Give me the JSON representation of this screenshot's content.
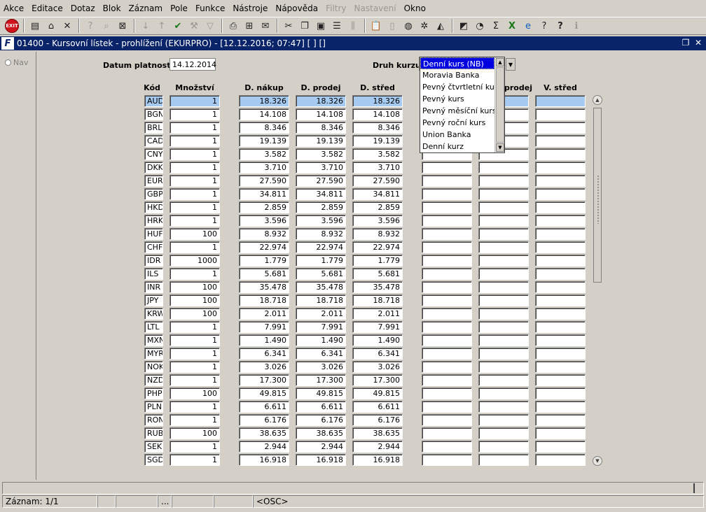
{
  "menu": [
    {
      "label": "Akce",
      "disabled": false
    },
    {
      "label": "Editace",
      "disabled": false
    },
    {
      "label": "Dotaz",
      "disabled": false
    },
    {
      "label": "Blok",
      "disabled": false
    },
    {
      "label": "Záznam",
      "disabled": false
    },
    {
      "label": "Pole",
      "disabled": false
    },
    {
      "label": "Funkce",
      "disabled": false
    },
    {
      "label": "Nástroje",
      "disabled": false
    },
    {
      "label": "Nápověda",
      "disabled": false
    },
    {
      "label": "Filtry",
      "disabled": true
    },
    {
      "label": "Nastavení",
      "disabled": true
    },
    {
      "label": "Okno",
      "disabled": false
    }
  ],
  "toolbar": {
    "exit_label": "EXIT"
  },
  "window": {
    "title": "01400 - Kursovní lístek - prohlížení (EKURPRO) - [12.12.2016; 07:47] [ ] []",
    "logo": "F"
  },
  "nav": {
    "label": "Nav"
  },
  "form": {
    "datum_label": "Datum platnosti",
    "datum_value": "14.12.2014",
    "druh_label": "Druh kurzu"
  },
  "columns": {
    "kod": "Kód",
    "mnozstvi": "Množství",
    "d_nakup": "D. nákup",
    "d_prodej": "D. prodej",
    "d_stred": "D. střed",
    "v_prodej": "prodej",
    "v_stred": "V. střed"
  },
  "dropdown": {
    "options": [
      "Denní kurs (NB)",
      "Moravia Banka",
      "Pevný čtvrtletní kurs",
      "Pevný kurs",
      "Pevný měsíční kurs",
      "Pevný roční kurs",
      "Union Banka",
      "Denní kurz"
    ],
    "selected_index": 0
  },
  "rows": [
    {
      "kod": "AUD",
      "mn": "1",
      "nakup": "18.326",
      "prodej": "18.326",
      "stred": "18.326"
    },
    {
      "kod": "BGN",
      "mn": "1",
      "nakup": "14.108",
      "prodej": "14.108",
      "stred": "14.108"
    },
    {
      "kod": "BRL",
      "mn": "1",
      "nakup": "8.346",
      "prodej": "8.346",
      "stred": "8.346"
    },
    {
      "kod": "CAD",
      "mn": "1",
      "nakup": "19.139",
      "prodej": "19.139",
      "stred": "19.139"
    },
    {
      "kod": "CNY",
      "mn": "1",
      "nakup": "3.582",
      "prodej": "3.582",
      "stred": "3.582"
    },
    {
      "kod": "DKK",
      "mn": "1",
      "nakup": "3.710",
      "prodej": "3.710",
      "stred": "3.710"
    },
    {
      "kod": "EUR",
      "mn": "1",
      "nakup": "27.590",
      "prodej": "27.590",
      "stred": "27.590"
    },
    {
      "kod": "GBP",
      "mn": "1",
      "nakup": "34.811",
      "prodej": "34.811",
      "stred": "34.811"
    },
    {
      "kod": "HKD",
      "mn": "1",
      "nakup": "2.859",
      "prodej": "2.859",
      "stred": "2.859"
    },
    {
      "kod": "HRK",
      "mn": "1",
      "nakup": "3.596",
      "prodej": "3.596",
      "stred": "3.596"
    },
    {
      "kod": "HUF",
      "mn": "100",
      "nakup": "8.932",
      "prodej": "8.932",
      "stred": "8.932"
    },
    {
      "kod": "CHF",
      "mn": "1",
      "nakup": "22.974",
      "prodej": "22.974",
      "stred": "22.974"
    },
    {
      "kod": "IDR",
      "mn": "1000",
      "nakup": "1.779",
      "prodej": "1.779",
      "stred": "1.779"
    },
    {
      "kod": "ILS",
      "mn": "1",
      "nakup": "5.681",
      "prodej": "5.681",
      "stred": "5.681"
    },
    {
      "kod": "INR",
      "mn": "100",
      "nakup": "35.478",
      "prodej": "35.478",
      "stred": "35.478"
    },
    {
      "kod": "JPY",
      "mn": "100",
      "nakup": "18.718",
      "prodej": "18.718",
      "stred": "18.718"
    },
    {
      "kod": "KRW",
      "mn": "100",
      "nakup": "2.011",
      "prodej": "2.011",
      "stred": "2.011"
    },
    {
      "kod": "LTL",
      "mn": "1",
      "nakup": "7.991",
      "prodej": "7.991",
      "stred": "7.991"
    },
    {
      "kod": "MXN",
      "mn": "1",
      "nakup": "1.490",
      "prodej": "1.490",
      "stred": "1.490"
    },
    {
      "kod": "MYR",
      "mn": "1",
      "nakup": "6.341",
      "prodej": "6.341",
      "stred": "6.341"
    },
    {
      "kod": "NOK",
      "mn": "1",
      "nakup": "3.026",
      "prodej": "3.026",
      "stred": "3.026"
    },
    {
      "kod": "NZD",
      "mn": "1",
      "nakup": "17.300",
      "prodej": "17.300",
      "stred": "17.300"
    },
    {
      "kod": "PHP",
      "mn": "100",
      "nakup": "49.815",
      "prodej": "49.815",
      "stred": "49.815"
    },
    {
      "kod": "PLN",
      "mn": "1",
      "nakup": "6.611",
      "prodej": "6.611",
      "stred": "6.611"
    },
    {
      "kod": "RON",
      "mn": "1",
      "nakup": "6.176",
      "prodej": "6.176",
      "stred": "6.176"
    },
    {
      "kod": "RUB",
      "mn": "100",
      "nakup": "38.635",
      "prodej": "38.635",
      "stred": "38.635"
    },
    {
      "kod": "SEK",
      "mn": "1",
      "nakup": "2.944",
      "prodej": "2.944",
      "stred": "2.944"
    },
    {
      "kod": "SGD",
      "mn": "1",
      "nakup": "16.918",
      "prodej": "16.918",
      "stred": "16.918"
    }
  ],
  "status": {
    "zaznam": "Záznam: 1/1",
    "dots": "...",
    "osc": "<OSC>"
  },
  "colors": {
    "title_bar": "#0a246a",
    "selected_row": "#a6caf0",
    "selected_option": "#0000e0"
  }
}
